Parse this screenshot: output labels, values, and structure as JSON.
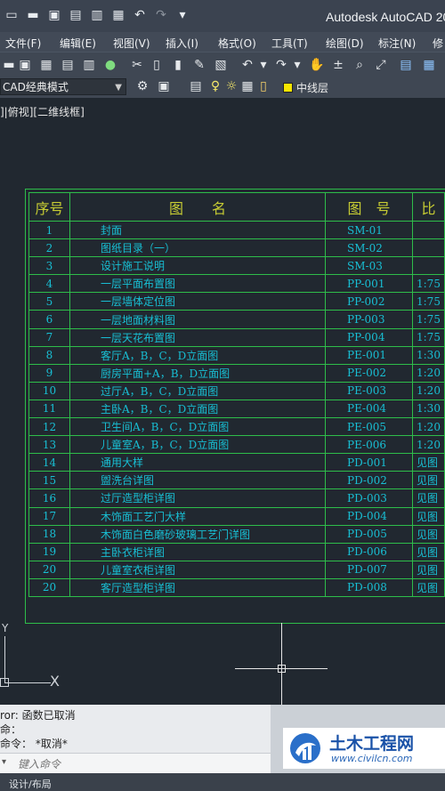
{
  "window": {
    "title": "Autodesk AutoCAD 20",
    "quick_access": [
      "new-icon",
      "open-icon",
      "save-icon",
      "save-as-icon",
      "export-icon",
      "print-icon",
      "undo-icon",
      "redo-icon",
      "dropdown-icon"
    ]
  },
  "menu": {
    "items": [
      "文件(F)",
      "编辑(E)",
      "视图(V)",
      "插入(I)",
      "格式(O)",
      "工具(T)",
      "绘图(D)",
      "标注(N)",
      "修"
    ]
  },
  "workspace": {
    "current": "CAD经典模式"
  },
  "layer": {
    "current": "中线层",
    "color": "#f7e600"
  },
  "viewport": {
    "label": "]|俯视][二维线框]"
  },
  "drawing_table": {
    "headers": [
      "序号",
      "图　　名",
      "图　号",
      "比"
    ],
    "rows": [
      {
        "seq": "1",
        "name": "封面",
        "num": "SM-01",
        "scale": ""
      },
      {
        "seq": "2",
        "name": "图纸目录（一）",
        "num": "SM-02",
        "scale": ""
      },
      {
        "seq": "3",
        "name": "设计施工说明",
        "num": "SM-03",
        "scale": ""
      },
      {
        "seq": "4",
        "name": "一层平面布置图",
        "num": "PP-001",
        "scale": "1:75"
      },
      {
        "seq": "5",
        "name": "一层墙体定位图",
        "num": "PP-002",
        "scale": "1:75"
      },
      {
        "seq": "6",
        "name": "一层地面材料图",
        "num": "PP-003",
        "scale": "1:75"
      },
      {
        "seq": "7",
        "name": "一层天花布置图",
        "num": "PP-004",
        "scale": "1:75"
      },
      {
        "seq": "8",
        "name": "客厅A，B，C，D立面图",
        "num": "PE-001",
        "scale": "1:30"
      },
      {
        "seq": "9",
        "name": "厨房平面+A，B，D立面图",
        "num": "PE-002",
        "scale": "1:20"
      },
      {
        "seq": "10",
        "name": "过厅A，B，C，D立面图",
        "num": "PE-003",
        "scale": "1:20"
      },
      {
        "seq": "11",
        "name": "主卧A，B，C，D立面图",
        "num": "PE-004",
        "scale": "1:30"
      },
      {
        "seq": "12",
        "name": "卫生间A，B，C，D立面图",
        "num": "PE-005",
        "scale": "1:20"
      },
      {
        "seq": "13",
        "name": "儿童室A，B，C，D立面图",
        "num": "PE-006",
        "scale": "1:20"
      },
      {
        "seq": "14",
        "name": "通用大样",
        "num": "PD-001",
        "scale": "见图"
      },
      {
        "seq": "15",
        "name": "盥洗台详图",
        "num": "PD-002",
        "scale": "见图"
      },
      {
        "seq": "16",
        "name": "过厅造型柜详图",
        "num": "PD-003",
        "scale": "见图"
      },
      {
        "seq": "17",
        "name": "木饰面工艺门大样",
        "num": "PD-004",
        "scale": "见图"
      },
      {
        "seq": "18",
        "name": "木饰面白色磨砂玻璃工艺门详图",
        "num": "PD-005",
        "scale": "见图"
      },
      {
        "seq": "19",
        "name": "主卧衣柜详图",
        "num": "PD-006",
        "scale": "见图"
      },
      {
        "seq": "20",
        "name": "儿童室衣柜详图",
        "num": "PD-007",
        "scale": "见图"
      },
      {
        "seq": "20",
        "name": "客厅造型柜详图",
        "num": "PD-008",
        "scale": "见图"
      }
    ]
  },
  "ucs": {
    "y_label": "Y",
    "x_label": "X"
  },
  "command": {
    "history": [
      "ror:  函数已取消",
      "命：",
      "命令： *取消*"
    ],
    "placeholder": "键入命令"
  },
  "watermark": {
    "title": "土木工程网",
    "url": "www.civilcn.com"
  },
  "status": {
    "tab_label": "设计/布局"
  }
}
